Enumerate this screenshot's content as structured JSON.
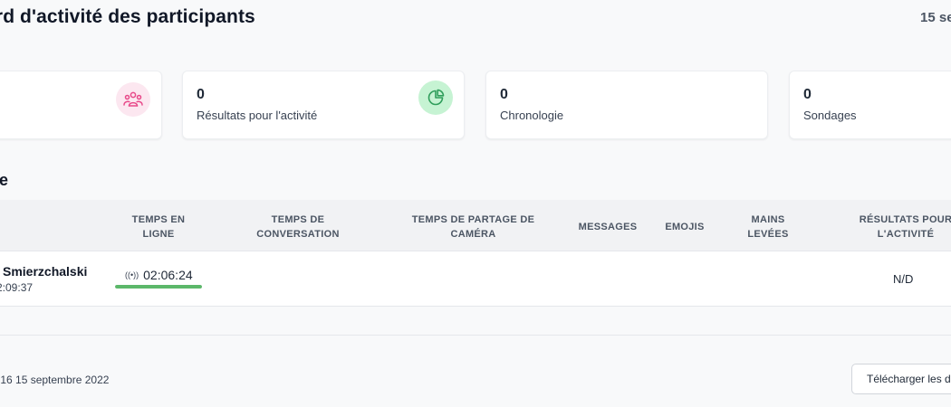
{
  "header": {
    "title": "ord d'activité des participants",
    "date": "15 se"
  },
  "cards": [
    {
      "label": "",
      "icon": "participants-icon",
      "color": "#e84a8a"
    },
    {
      "value": "0",
      "label": "Résultats pour l'activité",
      "icon": "pie-chart-icon",
      "color": "#3db86b"
    },
    {
      "value": "0",
      "label": "Chronologie"
    },
    {
      "value": "0",
      "label": "Sondages"
    }
  ],
  "section": {
    "title": "le"
  },
  "table": {
    "columns": [
      "TEMPS EN LIGNE",
      "TEMPS DE CONVERSATION",
      "TEMPS DE PARTAGE DE CAMÉRA",
      "MESSAGES",
      "EMOJIS",
      "MAINS LEVÉES",
      "RÉSULTATS POUR L'ACTIVITÉ"
    ],
    "rows": [
      {
        "name": "Smierzchalski",
        "time": "2:09:37",
        "online_time": "02:06:24",
        "online_progress": 1.0,
        "activity_results": "N/D"
      }
    ]
  },
  "footer": {
    "date": ":16 15 septembre 2022",
    "download_label": "Télécharger les d"
  }
}
